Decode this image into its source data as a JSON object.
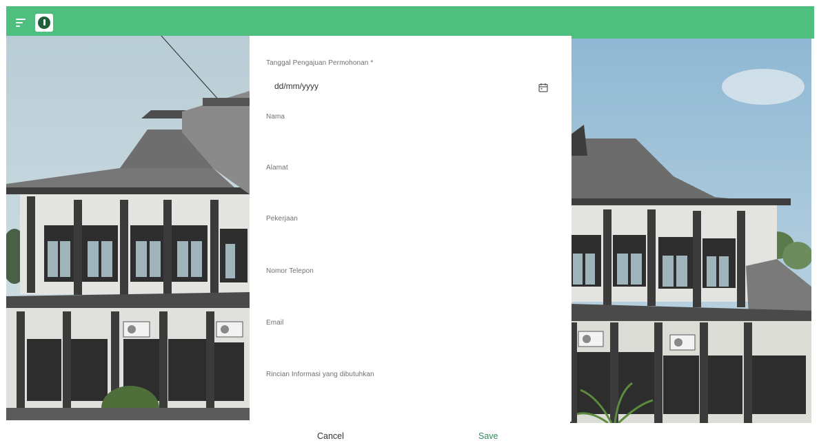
{
  "header": {
    "menu_icon": "menu-icon",
    "logo_icon": "logo-icon",
    "accent": "#4fbf7f"
  },
  "form": {
    "fields": [
      {
        "label": "Tanggal Pengajuan Permohonan *",
        "placeholder": "dd/mm/yyyy",
        "icon": "calendar-icon"
      },
      {
        "label": "Nama"
      },
      {
        "label": "Alamat"
      },
      {
        "label": "Pekerjaan"
      },
      {
        "label": "Nomor Telepon"
      },
      {
        "label": "Email"
      },
      {
        "label": "Rincian Informasi yang dibutuhkan"
      }
    ]
  },
  "actions": {
    "cancel_label": "Cancel",
    "save_label": "Save"
  }
}
